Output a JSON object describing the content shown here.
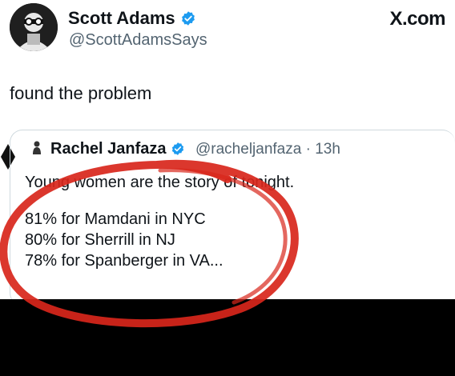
{
  "post": {
    "author_name": "Scott Adams",
    "author_handle": "@ScottAdamsSays",
    "text": "found the problem",
    "avatar_icon": "avatar-icon",
    "verified_icon": "verified-badge-icon",
    "verified_color": "#1d9bf0"
  },
  "brand": {
    "label": "X.com"
  },
  "quote": {
    "author_name": "Rachel Janfaza",
    "author_handle": "@racheljanfaza",
    "separator": "·",
    "time": "13h",
    "lines": [
      "Young women are the story of tonight.",
      "81% for Mamdani in NYC",
      "80% for Sherrill in NJ",
      "78% for Spanberger in VA..."
    ]
  },
  "annotation": {
    "color": "#d8261b",
    "shape": "hand-drawn-circle"
  },
  "colors": {
    "text": "#0f1419",
    "muted": "#536471",
    "border": "#cfd9de",
    "bottom_bar": "#000000"
  }
}
